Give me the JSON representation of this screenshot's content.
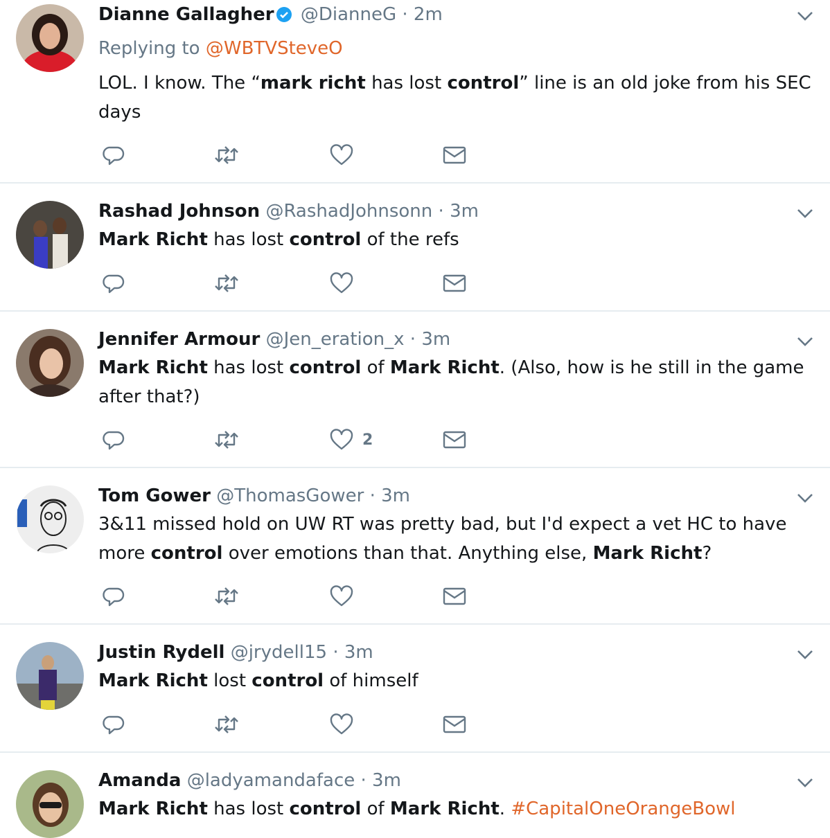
{
  "colors": {
    "accent": "#e0662a",
    "muted": "#657786",
    "text": "#14171a",
    "verified": "#1da1f2",
    "divider": "#e6ecf0"
  },
  "icons": {
    "reply": "reply-icon",
    "retweet": "retweet-icon",
    "like": "heart-icon",
    "dm": "mail-icon",
    "more": "chevron-down-icon",
    "verified": "verified-badge-icon"
  },
  "tweets": [
    {
      "name": "Dianne Gallagher",
      "verified": true,
      "handle": "@DianneG",
      "sep": "·",
      "time": "2m",
      "replying_prefix": "Replying to ",
      "replying_handle": "@WBTVSteveO",
      "text": [
        {
          "t": "LOL. I know. The “"
        },
        {
          "t": "mark richt",
          "b": true
        },
        {
          "t": " has lost "
        },
        {
          "t": "control",
          "b": true
        },
        {
          "t": "” line is an old joke from his SEC days"
        }
      ],
      "likes": ""
    },
    {
      "name": "Rashad Johnson",
      "handle": "@RashadJohnsonn",
      "sep": "·",
      "time": "3m",
      "text": [
        {
          "t": "Mark Richt",
          "b": true
        },
        {
          "t": " has lost "
        },
        {
          "t": "control",
          "b": true
        },
        {
          "t": " of the refs"
        }
      ],
      "likes": ""
    },
    {
      "name": "Jennifer Armour",
      "handle": "@Jen_eration_x",
      "sep": "·",
      "time": "3m",
      "text": [
        {
          "t": "Mark Richt",
          "b": true
        },
        {
          "t": " has lost "
        },
        {
          "t": "control",
          "b": true
        },
        {
          "t": " of "
        },
        {
          "t": "Mark Richt",
          "b": true
        },
        {
          "t": ". (Also, how is he still in the game after that?)"
        }
      ],
      "likes": "2"
    },
    {
      "name": "Tom Gower",
      "handle": "@ThomasGower",
      "sep": "·",
      "time": "3m",
      "text": [
        {
          "t": "3&11 missed hold on UW RT was pretty bad, but I'd expect a vet HC to have more "
        },
        {
          "t": "control",
          "b": true
        },
        {
          "t": " over emotions than that. Anything else, "
        },
        {
          "t": "Mark Richt",
          "b": true
        },
        {
          "t": "?"
        }
      ],
      "likes": ""
    },
    {
      "name": "Justin Rydell",
      "handle": "@jrydell15",
      "sep": "·",
      "time": "3m",
      "text": [
        {
          "t": "Mark Richt",
          "b": true
        },
        {
          "t": " lost "
        },
        {
          "t": "control",
          "b": true
        },
        {
          "t": " of himself"
        }
      ],
      "likes": ""
    },
    {
      "name": "Amanda",
      "handle": "@ladyamandaface",
      "sep": "·",
      "time": "3m",
      "text": [
        {
          "t": "Mark Richt",
          "b": true
        },
        {
          "t": " has lost "
        },
        {
          "t": "control",
          "b": true
        },
        {
          "t": " of "
        },
        {
          "t": "Mark Richt",
          "b": true
        },
        {
          "t": ". "
        },
        {
          "t": "#CapitalOneOrangeBowl",
          "tag": true
        }
      ],
      "likes": ""
    }
  ]
}
